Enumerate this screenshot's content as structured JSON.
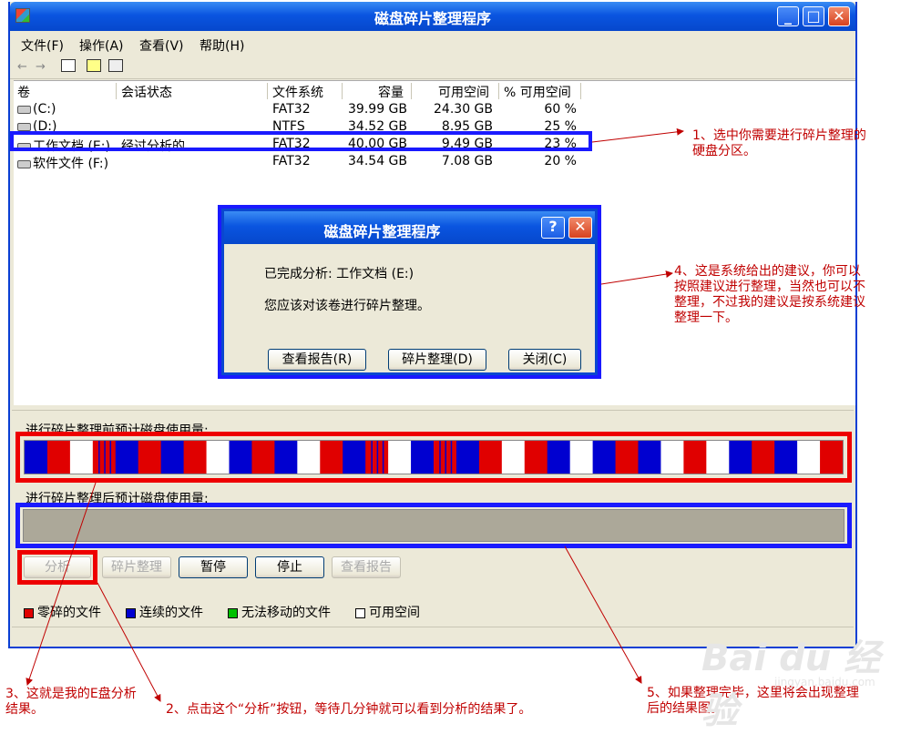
{
  "window": {
    "title": "磁盘碎片整理程序"
  },
  "menu": [
    "文件(F)",
    "操作(A)",
    "查看(V)",
    "帮助(H)"
  ],
  "toolbar": {
    "back": "←",
    "forward": "→"
  },
  "list": {
    "headers": {
      "volume": "卷",
      "session": "会话状态",
      "fs": "文件系统",
      "capacity": "容量",
      "free": "可用空间",
      "pct": "% 可用空间"
    },
    "rows": [
      {
        "volume": "(C:)",
        "session": "",
        "fs": "FAT32",
        "capacity": "39.99 GB",
        "free": "24.30 GB",
        "pct": "60 %"
      },
      {
        "volume": "(D:)",
        "session": "",
        "fs": "NTFS",
        "capacity": "34.52 GB",
        "free": "8.95 GB",
        "pct": "25 %"
      },
      {
        "volume": "工作文档 (E:)",
        "session": "经过分析的",
        "fs": "FAT32",
        "capacity": "40.00 GB",
        "free": "9.49 GB",
        "pct": "23 %"
      },
      {
        "volume": "软件文件 (F:)",
        "session": "",
        "fs": "FAT32",
        "capacity": "34.54 GB",
        "free": "7.08 GB",
        "pct": "20 %"
      }
    ]
  },
  "dialog": {
    "title": "磁盘碎片整理程序",
    "help": "?",
    "close": "✕",
    "line1": "已完成分析: 工作文档 (E:)",
    "line2": "您应该对该卷进行碎片整理。",
    "btn_report": "查看报告(R)",
    "btn_defrag": "碎片整理(D)",
    "btn_close": "关闭(C)"
  },
  "usage": {
    "before_label": "进行碎片整理前预计磁盘使用量:",
    "after_label": "进行碎片整理后预计磁盘使用量:"
  },
  "buttons": {
    "analyze": "分析",
    "defrag": "碎片整理",
    "pause": "暂停",
    "stop": "停止",
    "report": "查看报告"
  },
  "legend": {
    "fragmented": "零碎的文件",
    "contiguous": "连续的文件",
    "unmovable": "无法移动的文件",
    "free": "可用空间"
  },
  "colors": {
    "fragmented": "#e00000",
    "contiguous": "#0000d0",
    "unmovable": "#00c000",
    "free": "#ffffff",
    "highlight_blue": "#1a1aff",
    "highlight_red": "#ee0000"
  },
  "notes": {
    "n1a": "1、选中你需要进行碎片整理的",
    "n1b": "硬盘分区。",
    "n4a": "4、这是系统给出的建议，你可以",
    "n4b": "按照建议进行整理，当然也可以不",
    "n4c": "整理，不过我的建议是按系统建议",
    "n4d": "整理一下。",
    "n3a": "3、这就是我的E盘分析",
    "n3b": "结果。",
    "n2": "2、点击这个“分析”按钮，等待几分钟就可以看到分析的结果了。",
    "n5a": "5、如果整理完毕，这里将会出现整理",
    "n5b": "后的结果图。"
  },
  "watermark": {
    "main": "Bai du 经验",
    "sub": "jingyan.baidu.com"
  },
  "chart_data": {
    "type": "bar",
    "before_segments": [
      "contiguous",
      "fragmented",
      "free",
      "fragmented",
      "contiguous",
      "fragmented",
      "contiguous",
      "fragmented",
      "free",
      "contiguous",
      "fragmented",
      "contiguous",
      "free",
      "fragmented",
      "contiguous",
      "fragmented",
      "free",
      "contiguous",
      "fragmented",
      "contiguous",
      "fragmented",
      "free",
      "fragmented",
      "contiguous",
      "free",
      "contiguous",
      "fragmented",
      "contiguous",
      "free",
      "fragmented",
      "free",
      "contiguous",
      "fragmented",
      "contiguous",
      "free",
      "fragmented"
    ]
  }
}
